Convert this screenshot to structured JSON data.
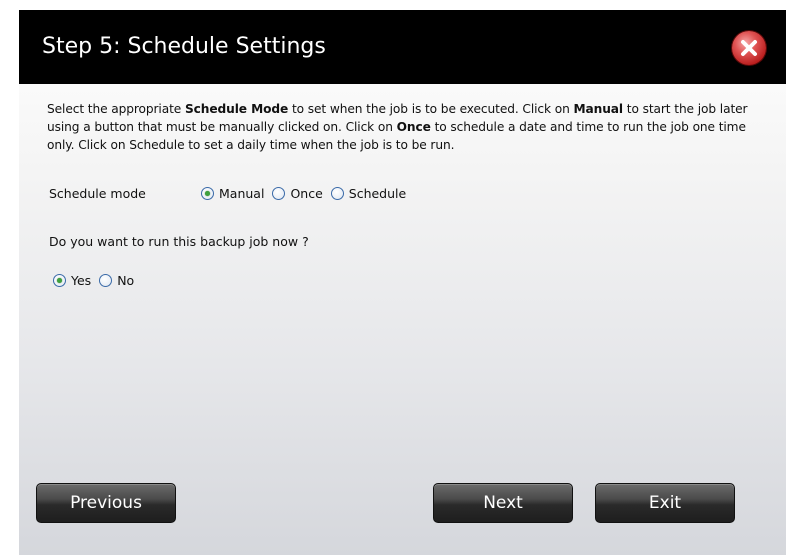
{
  "dialog": {
    "title": "Step 5: Schedule Settings",
    "close_icon": "close-icon"
  },
  "description": {
    "part1": "Select the appropriate ",
    "bold1": "Schedule Mode",
    "part2": " to set when the job is to be executed. Click on ",
    "bold2": "Manual",
    "part3": " to start the job later using a button that must be manually clicked on. Click on ",
    "bold3": "Once",
    "part4": " to schedule a date and time to run the job one time only. Click on Schedule to set a daily time when the job is to be run."
  },
  "schedule_mode": {
    "label": "Schedule mode",
    "options": [
      {
        "label": "Manual",
        "checked": true
      },
      {
        "label": "Once",
        "checked": false
      },
      {
        "label": "Schedule",
        "checked": false
      }
    ]
  },
  "run_now": {
    "question": "Do you want to run this backup job now ?",
    "options": [
      {
        "label": "Yes",
        "checked": true
      },
      {
        "label": "No",
        "checked": false
      }
    ]
  },
  "buttons": {
    "previous": "Previous",
    "next": "Next",
    "exit": "Exit"
  },
  "colors": {
    "titlebar": "#000000",
    "close_red": "#d03030",
    "radio_checked": "#3ea03e",
    "button_dark": "#2a2a2a"
  }
}
